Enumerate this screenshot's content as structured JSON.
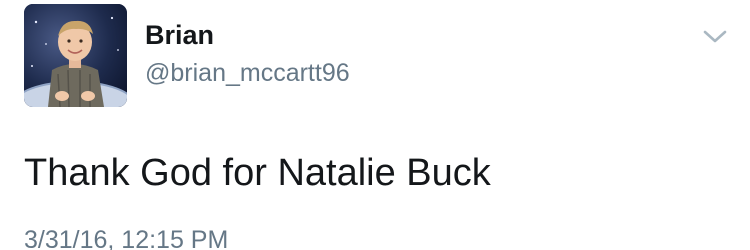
{
  "tweet": {
    "author": {
      "display_name": "Brian",
      "handle": "@brian_mccartt96"
    },
    "text": "Thank God for Natalie Buck",
    "timestamp": "3/31/16, 12:15 PM",
    "menu_icon": "chevron-down-icon"
  },
  "colors": {
    "name_text": "#14171a",
    "secondary_text": "#657786",
    "chevron": "#aab8c2"
  }
}
